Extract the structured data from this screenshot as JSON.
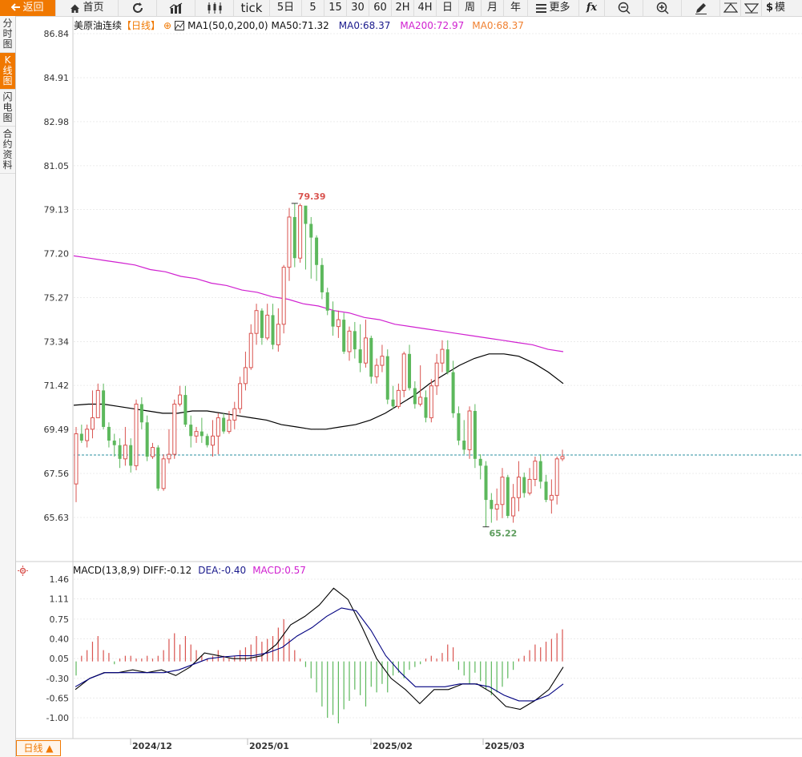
{
  "toolbar": {
    "back": "返回",
    "home": "首页",
    "tick": "tick",
    "periods": [
      "5日",
      "5",
      "15",
      "30",
      "60",
      "2H",
      "4H",
      "日",
      "周",
      "月",
      "年"
    ],
    "more": "更多",
    "fx": "fx",
    "last": "$",
    "last_extra": "模"
  },
  "sidebar": {
    "tabs": [
      {
        "label": "分时图"
      },
      {
        "label": "K线图",
        "active": true
      },
      {
        "label": "闪电图"
      },
      {
        "label": "合约资料"
      }
    ]
  },
  "price_legend": {
    "name": "美原油连续",
    "period": "【日线】",
    "ma1": "MA1(50,0,200,0)",
    "ma50": "MA50:71.32",
    "ma0a": "MA0:68.37",
    "ma200": "MA200:72.97",
    "ma0b": "MA0:68.37"
  },
  "macd_legend": {
    "name": "MACD(13,8,9)",
    "diff": "DIFF:-0.12",
    "dea": "DEA:-0.40",
    "macd": "MACD:0.57"
  },
  "colors": {
    "up": "#d9534f",
    "down": "#5cb85c",
    "ma50": "#000000",
    "ma200": "#d020d0",
    "ma0": "#f08030",
    "dea": "#000080",
    "accent": "#f07800"
  },
  "price_axis": {
    "ticks": [
      "86.84",
      "84.91",
      "82.98",
      "81.05",
      "79.13",
      "77.20",
      "75.27",
      "73.34",
      "71.42",
      "69.49",
      "67.56",
      "65.63"
    ],
    "high_label": "79.39",
    "low_label": "65.22",
    "last_price": 68.37
  },
  "macd_axis": {
    "ticks": [
      "1.46",
      "1.11",
      "0.75",
      "0.40",
      "0.05",
      "-0.30",
      "-0.65",
      "-1.00"
    ]
  },
  "date_axis": {
    "labels": [
      "2024/12",
      "2025/01",
      "2025/02",
      "2025/03"
    ]
  },
  "bottom_tab": "日线 ▲",
  "chart_data": {
    "type": "candlestick",
    "series": [
      {
        "name": "MA50",
        "values": [
          70.55,
          70.6,
          70.6,
          70.5,
          70.4,
          70.3,
          70.2,
          70.2,
          70.3,
          70.3,
          70.2,
          70.1,
          70.0,
          69.9,
          69.7,
          69.6,
          69.5,
          69.5,
          69.6,
          69.7,
          69.9,
          70.2,
          70.6,
          71.0,
          71.5,
          71.9,
          72.3,
          72.6,
          72.8,
          72.8,
          72.7,
          72.4,
          72.0,
          71.5
        ]
      },
      {
        "name": "MA200",
        "values": [
          77.1,
          77.0,
          76.9,
          76.8,
          76.7,
          76.5,
          76.4,
          76.2,
          76.1,
          75.9,
          75.8,
          75.6,
          75.5,
          75.3,
          75.2,
          75.0,
          74.9,
          74.7,
          74.6,
          74.4,
          74.3,
          74.1,
          74.0,
          73.9,
          73.8,
          73.7,
          73.6,
          73.5,
          73.4,
          73.3,
          73.2,
          73.0,
          72.9
        ]
      },
      {
        "name": "DIFF",
        "values": [
          -0.5,
          -0.3,
          -0.2,
          -0.2,
          -0.15,
          -0.2,
          -0.15,
          -0.25,
          -0.1,
          0.15,
          0.1,
          0.05,
          0.05,
          0.1,
          0.3,
          0.65,
          0.8,
          1.0,
          1.3,
          1.1,
          0.6,
          0.05,
          -0.3,
          -0.5,
          -0.75,
          -0.5,
          -0.5,
          -0.4,
          -0.4,
          -0.55,
          -0.8,
          -0.85,
          -0.7,
          -0.5,
          -0.1
        ]
      },
      {
        "name": "DEA",
        "values": [
          -0.45,
          -0.3,
          -0.2,
          -0.2,
          -0.2,
          -0.2,
          -0.2,
          -0.15,
          -0.05,
          0.05,
          0.08,
          0.1,
          0.1,
          0.15,
          0.25,
          0.45,
          0.6,
          0.8,
          0.95,
          0.9,
          0.55,
          0.1,
          -0.2,
          -0.45,
          -0.45,
          -0.45,
          -0.4,
          -0.4,
          -0.45,
          -0.6,
          -0.7,
          -0.7,
          -0.6,
          -0.4
        ]
      }
    ],
    "candles": [
      [
        67.1,
        69.3,
        69.6,
        66.3
      ],
      [
        69.3,
        69.0,
        69.7,
        68.9
      ],
      [
        69.0,
        69.5,
        69.7,
        68.7
      ],
      [
        69.5,
        70.0,
        71.2,
        69.1
      ],
      [
        70.0,
        71.2,
        71.5,
        70.5
      ],
      [
        71.2,
        69.6,
        71.5,
        69.5
      ],
      [
        69.6,
        69.0,
        69.8,
        68.7
      ],
      [
        69.0,
        68.8,
        69.3,
        68.3
      ],
      [
        68.8,
        68.2,
        69.1,
        67.8
      ],
      [
        68.2,
        68.8,
        69.6,
        67.9
      ],
      [
        68.8,
        67.9,
        69.1,
        67.6
      ],
      [
        67.9,
        70.6,
        70.8,
        67.7
      ],
      [
        70.6,
        69.8,
        70.9,
        69.5
      ],
      [
        69.8,
        68.3,
        70.1,
        68.1
      ],
      [
        68.3,
        68.7,
        68.9,
        68.2
      ],
      [
        68.7,
        66.9,
        68.8,
        66.8
      ],
      [
        66.9,
        68.2,
        68.4,
        66.8
      ],
      [
        68.2,
        68.4,
        69.5,
        68.0
      ],
      [
        68.4,
        70.6,
        70.8,
        68.2
      ],
      [
        70.6,
        71.0,
        71.4,
        70.5
      ],
      [
        71.0,
        69.7,
        71.4,
        69.6
      ],
      [
        69.7,
        69.2,
        70.1,
        68.7
      ],
      [
        69.2,
        69.4,
        69.6,
        68.9
      ],
      [
        69.4,
        69.2,
        70.0,
        68.9
      ],
      [
        69.2,
        68.8,
        69.3,
        68.7
      ],
      [
        68.8,
        69.2,
        69.9,
        68.3
      ],
      [
        69.2,
        70.0,
        70.2,
        68.4
      ],
      [
        70.0,
        69.4,
        70.2,
        69.3
      ],
      [
        69.4,
        69.9,
        70.3,
        69.3
      ],
      [
        69.9,
        70.4,
        70.7,
        69.5
      ],
      [
        70.4,
        71.5,
        71.8,
        70.2
      ],
      [
        71.5,
        72.2,
        72.9,
        71.2
      ],
      [
        72.2,
        73.7,
        74.1,
        72.1
      ],
      [
        73.7,
        74.7,
        75.0,
        73.2
      ],
      [
        74.7,
        73.5,
        74.8,
        73.2
      ],
      [
        73.5,
        74.5,
        75.0,
        73.4
      ],
      [
        74.5,
        73.2,
        75.0,
        73.0
      ],
      [
        73.2,
        74.1,
        74.8,
        72.9
      ],
      [
        74.1,
        76.6,
        76.7,
        73.7
      ],
      [
        76.6,
        78.8,
        79.2,
        76.0
      ],
      [
        78.8,
        77.0,
        79.4,
        76.6
      ],
      [
        77.0,
        79.3,
        79.39,
        76.8
      ],
      [
        79.3,
        78.5,
        79.0,
        76.5
      ],
      [
        78.5,
        77.9,
        78.8,
        76.1
      ],
      [
        77.9,
        76.7,
        78.0,
        76.0
      ],
      [
        76.7,
        75.5,
        77.0,
        75.2
      ],
      [
        75.5,
        74.7,
        75.7,
        74.5
      ],
      [
        74.7,
        74.0,
        75.1,
        73.6
      ],
      [
        74.0,
        74.3,
        74.7,
        73.5
      ],
      [
        74.3,
        72.9,
        74.6,
        72.8
      ],
      [
        72.9,
        73.8,
        74.0,
        72.5
      ],
      [
        73.8,
        73.0,
        74.2,
        72.6
      ],
      [
        73.0,
        72.4,
        74.1,
        72.0
      ],
      [
        72.4,
        73.5,
        74.3,
        72.2
      ],
      [
        73.5,
        71.8,
        73.6,
        71.5
      ],
      [
        71.8,
        72.3,
        72.6,
        71.5
      ],
      [
        72.3,
        72.7,
        73.2,
        72.0
      ],
      [
        72.7,
        70.8,
        73.0,
        70.6
      ],
      [
        70.8,
        70.5,
        71.4,
        70.4
      ],
      [
        70.5,
        71.2,
        71.5,
        70.4
      ],
      [
        71.2,
        72.8,
        72.9,
        70.9
      ],
      [
        72.8,
        71.3,
        73.2,
        71.2
      ],
      [
        71.3,
        70.6,
        71.6,
        70.4
      ],
      [
        70.6,
        70.9,
        72.3,
        70.5
      ],
      [
        70.9,
        70.0,
        71.2,
        69.8
      ],
      [
        70.0,
        71.4,
        71.7,
        69.8
      ],
      [
        71.4,
        72.4,
        72.8,
        71.0
      ],
      [
        72.4,
        73.0,
        73.4,
        72.0
      ],
      [
        73.0,
        72.0,
        73.4,
        71.9
      ],
      [
        72.0,
        70.2,
        72.5,
        70.0
      ],
      [
        70.2,
        69.0,
        70.5,
        68.8
      ],
      [
        69.0,
        68.6,
        69.9,
        68.4
      ],
      [
        68.6,
        70.3,
        70.5,
        68.2
      ],
      [
        70.3,
        68.2,
        70.6,
        67.8
      ],
      [
        68.2,
        67.9,
        68.4,
        67.3
      ],
      [
        67.9,
        66.4,
        68.1,
        65.22
      ],
      [
        66.4,
        66.0,
        66.7,
        65.4
      ],
      [
        66.0,
        66.2,
        66.9,
        65.5
      ],
      [
        66.2,
        67.4,
        67.8,
        65.6
      ],
      [
        67.4,
        65.7,
        67.5,
        65.6
      ],
      [
        65.7,
        66.5,
        67.1,
        65.4
      ],
      [
        66.5,
        67.4,
        68.1,
        65.9
      ],
      [
        67.4,
        66.7,
        67.6,
        66.5
      ],
      [
        66.7,
        67.3,
        67.8,
        66.6
      ],
      [
        67.3,
        68.1,
        68.3,
        67.0
      ],
      [
        68.1,
        67.2,
        68.4,
        66.9
      ],
      [
        67.2,
        66.4,
        67.5,
        66.3
      ],
      [
        66.4,
        66.6,
        67.3,
        65.8
      ],
      [
        66.6,
        68.2,
        68.3,
        66.2
      ],
      [
        68.2,
        68.3,
        68.6,
        68.1
      ]
    ],
    "macd_hist": [
      -0.25,
      0.1,
      0.2,
      0.35,
      0.45,
      0.2,
      0.15,
      -0.05,
      0.05,
      0.1,
      0.1,
      0.05,
      0.05,
      0.1,
      0.05,
      0.1,
      0.2,
      0.4,
      0.5,
      0.3,
      0.45,
      0.3,
      0.2,
      0.1,
      0.05,
      0.1,
      0.2,
      0.1,
      0.05,
      0.1,
      0.2,
      0.25,
      0.3,
      0.45,
      0.35,
      0.4,
      0.45,
      0.6,
      0.75,
      0.4,
      0.2,
      0.05,
      -0.1,
      -0.3,
      -0.55,
      -0.8,
      -1.0,
      -0.95,
      -1.1,
      -0.85,
      -0.7,
      -0.5,
      -0.6,
      -0.8,
      -0.45,
      -0.55,
      -0.4,
      -0.55,
      -0.25,
      -0.2,
      -0.3,
      -0.15,
      -0.1,
      -0.05,
      0.05,
      0.1,
      0.05,
      0.15,
      0.3,
      0.25,
      -0.15,
      -0.25,
      -0.4,
      -0.2,
      -0.35,
      -0.5,
      -0.6,
      -0.55,
      -0.45,
      -0.3,
      -0.15,
      0.05,
      0.1,
      0.2,
      0.3,
      0.25,
      0.35,
      0.4,
      0.5,
      0.57
    ]
  }
}
